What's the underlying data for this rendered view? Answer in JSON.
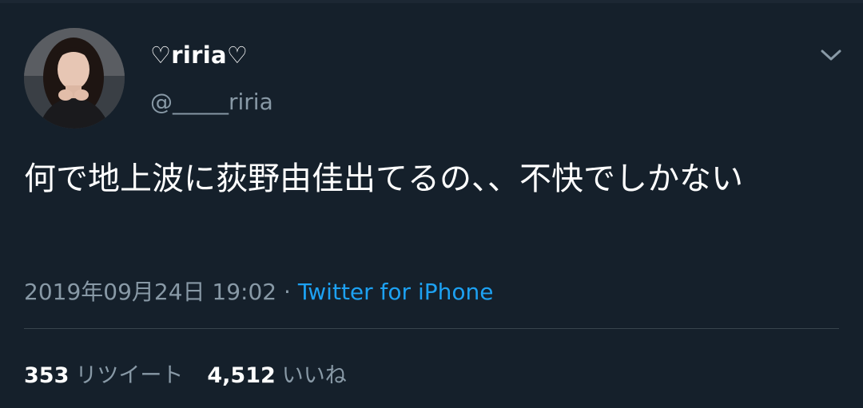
{
  "user": {
    "display_name": "♡riria♡",
    "handle": "@_____riria"
  },
  "tweet": {
    "text": "何で地上波に荻野由佳出てるの、、不快でしかない",
    "timestamp": "2019年09月24日 19:02",
    "separator": " · ",
    "source": "Twitter for iPhone"
  },
  "stats": {
    "retweets_count": "353",
    "retweets_label": "リツイート",
    "likes_count": "4,512",
    "likes_label": "いいね"
  },
  "icons": {
    "menu": "chevron-down-icon"
  },
  "colors": {
    "background": "#15202b",
    "secondary_text": "#8899a6",
    "link": "#1da1f2",
    "divider": "#38444d"
  }
}
